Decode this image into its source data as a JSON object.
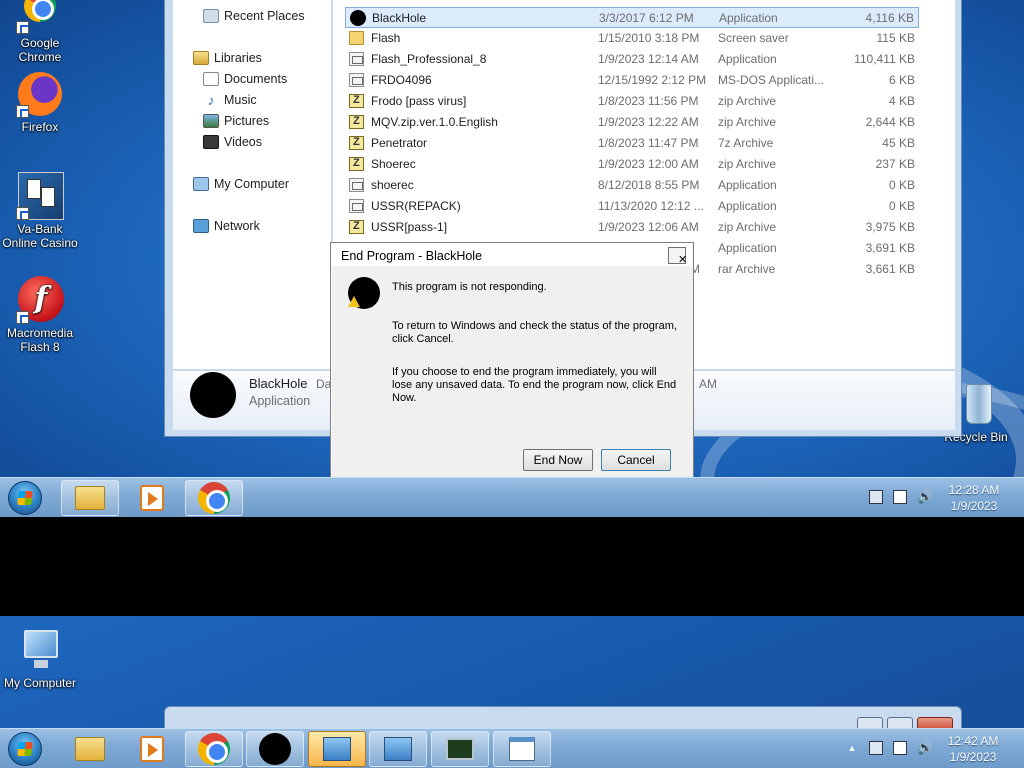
{
  "upper": {
    "desktop_icons": [
      {
        "name": "google-chrome-desktop-icon",
        "label": "Google Chrome"
      },
      {
        "name": "firefox-desktop-icon",
        "label": "Firefox"
      },
      {
        "name": "va-bank-desktop-icon",
        "label": "Va-Bank Online Casino"
      },
      {
        "name": "macromedia-flash-desktop-icon",
        "label": "Macromedia Flash 8"
      },
      {
        "name": "recycle-bin-desktop-icon",
        "label": "Recycle Bin"
      }
    ],
    "nav": [
      {
        "label": "Recent Places",
        "icon": "recent-places-icon"
      },
      {
        "label": "Libraries",
        "icon": "libraries-icon"
      },
      {
        "label": "Documents",
        "icon": "documents-icon"
      },
      {
        "label": "Music",
        "icon": "music-icon"
      },
      {
        "label": "Pictures",
        "icon": "pictures-icon"
      },
      {
        "label": "Videos",
        "icon": "videos-icon"
      },
      {
        "label": "My Computer",
        "icon": "computer-icon"
      },
      {
        "label": "Network",
        "icon": "network-icon"
      }
    ],
    "files": [
      {
        "name": "BlackHole",
        "date": "3/3/2017 6:12 PM",
        "type": "Application",
        "size": "4,116 KB",
        "icon": "blackhole-icon",
        "selected": true
      },
      {
        "name": "Flash",
        "date": "1/15/2010 3:18 PM",
        "type": "Screen saver",
        "size": "115 KB",
        "icon": "folder-icon"
      },
      {
        "name": "Flash_Professional_8",
        "date": "1/9/2023 12:14 AM",
        "type": "Application",
        "size": "110,411 KB",
        "icon": "application-icon"
      },
      {
        "name": "FRDO4096",
        "date": "12/15/1992 2:12 PM",
        "type": "MS-DOS Applicati...",
        "size": "6 KB",
        "icon": "application-icon"
      },
      {
        "name": "Frodo [pass virus]",
        "date": "1/8/2023 11:56 PM",
        "type": "zip Archive",
        "size": "4 KB",
        "icon": "zip-archive-icon"
      },
      {
        "name": "MQV.zip.ver.1.0.English",
        "date": "1/9/2023 12:22 AM",
        "type": "zip Archive",
        "size": "2,644 KB",
        "icon": "zip-archive-icon"
      },
      {
        "name": "Penetrator",
        "date": "1/8/2023 11:47 PM",
        "type": "7z Archive",
        "size": "45 KB",
        "icon": "zip-archive-icon"
      },
      {
        "name": "Shoerec",
        "date": "1/9/2023 12:00 AM",
        "type": "zip Archive",
        "size": "237 KB",
        "icon": "zip-archive-icon"
      },
      {
        "name": "shoerec",
        "date": "8/12/2018 8:55 PM",
        "type": "Application",
        "size": "0 KB",
        "icon": "application-icon"
      },
      {
        "name": "USSR(REPACK)",
        "date": "11/13/2020 12:12 ...",
        "type": "Application",
        "size": "0 KB",
        "icon": "application-icon"
      },
      {
        "name": "USSR[pass-1]",
        "date": "1/9/2023 12:06 AM",
        "type": "zip Archive",
        "size": "3,975 KB",
        "icon": "zip-archive-icon"
      },
      {
        "name": "",
        "date": "",
        "type": "Application",
        "size": "3,691 KB",
        "icon": ""
      },
      {
        "name": "",
        "date": "AM",
        "type": "rar Archive",
        "size": "3,661 KB",
        "icon": ""
      }
    ],
    "details": {
      "name": "BlackHole",
      "type": "Application",
      "date_label": "Da",
      "date_tail": "AM"
    },
    "dialog": {
      "title": "End Program - BlackHole",
      "close": "✕",
      "line1": "This program is not responding.",
      "line2": "To return to Windows and check the status of the program, click Cancel.",
      "line3": "If you choose to end the program immediately, you will lose any unsaved data. To end the program now, click End Now.",
      "end_now": "End Now",
      "cancel": "Cancel"
    },
    "clock": {
      "time": "12:28 AM",
      "date": "1/9/2023"
    }
  },
  "lower": {
    "desktop_icon": "My Computer",
    "clock": {
      "time": "12:42 AM",
      "date": "1/9/2023"
    },
    "tray_arrow": "▲"
  },
  "colors": {
    "accent": "#1f6bc2",
    "selection": "#dcebfc",
    "taskbar": "#7ea9d5"
  }
}
